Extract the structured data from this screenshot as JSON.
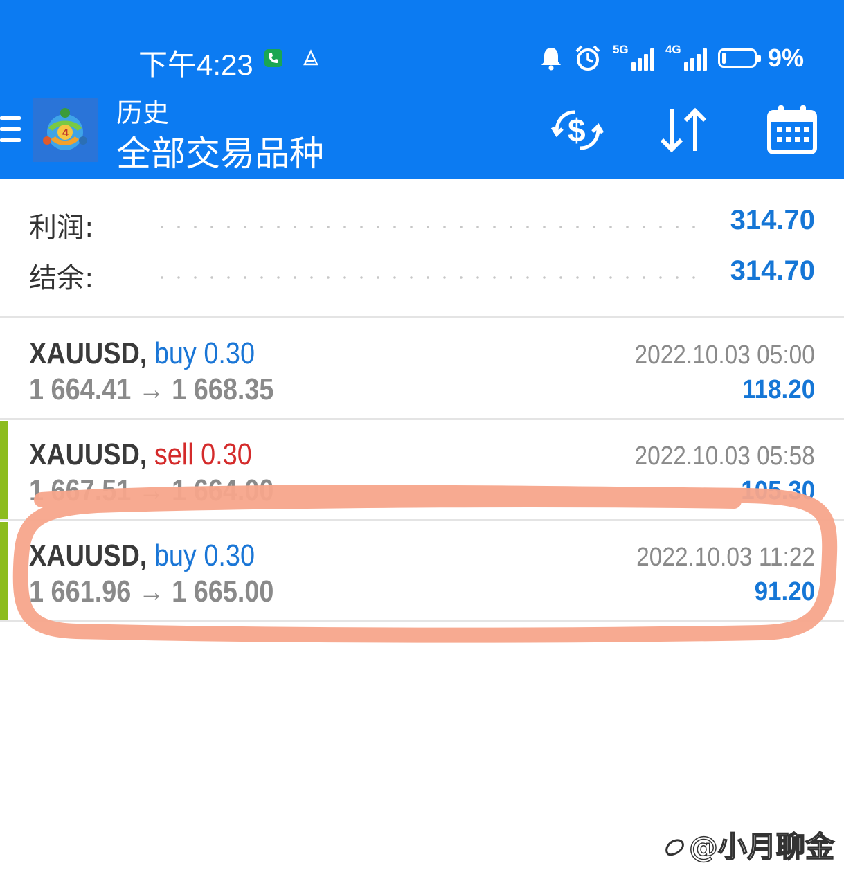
{
  "status_bar": {
    "time": "下午4:23",
    "network_1": "5G",
    "network_2": "4G",
    "battery": "9%"
  },
  "app_bar": {
    "subtitle": "历史",
    "title": "全部交易品种",
    "icons": [
      "menu-icon",
      "mt4-logo",
      "currency-exchange-icon",
      "sort-icon",
      "calendar-icon"
    ]
  },
  "summary": {
    "profit_label": "利润:",
    "profit_value": "314.70",
    "balance_label": "结余:",
    "balance_value": "314.70"
  },
  "trades": [
    {
      "symbol": "XAUUSD,",
      "side": "buy",
      "volume": "0.30",
      "open_price": "1 664.41",
      "close_price": "1 668.35",
      "time": "2022.10.03 05:00",
      "profit": "118.20"
    },
    {
      "symbol": "XAUUSD,",
      "side": "sell",
      "volume": "0.30",
      "open_price": "1 667.51",
      "close_price": "1 664.00",
      "time": "2022.10.03 05:58",
      "profit": "105.30"
    },
    {
      "symbol": "XAUUSD,",
      "side": "buy",
      "volume": "0.30",
      "open_price": "1 661.96",
      "close_price": "1 665.00",
      "time": "2022.10.03 11:22",
      "profit": "91.20"
    }
  ],
  "arrow": "→",
  "watermark": "@小月聊金",
  "colors": {
    "header": "#0c7bf2",
    "buy": "#1a76d6",
    "sell": "#d42b2b",
    "profit": "#1576d6",
    "accent": "#8cbc1e",
    "annotation": "#f7a58b"
  }
}
